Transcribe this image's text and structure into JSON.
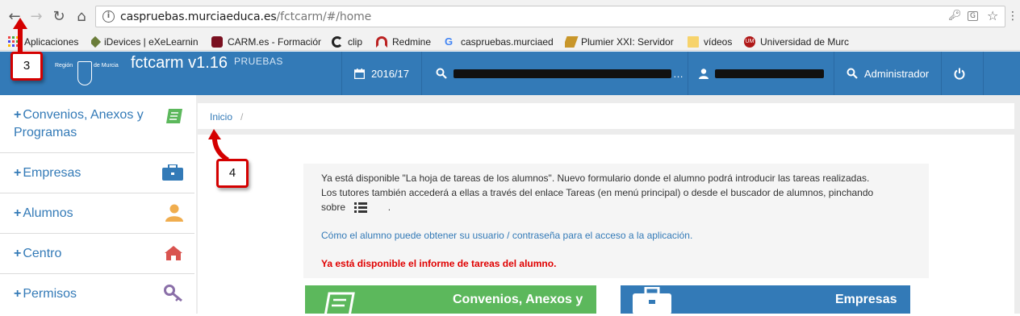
{
  "browser": {
    "url_host": "caspruebas.murciaeduca.es",
    "url_path": "/fctcarm/#/home",
    "bookmarks": [
      {
        "label": "Aplicaciones",
        "icon": "apps-grid-icon"
      },
      {
        "label": "iDevices | eXeLearnin",
        "icon": "idevices-icon"
      },
      {
        "label": "CARM.es - Formación",
        "icon": "carm-icon"
      },
      {
        "label": "clip",
        "icon": "clip-icon"
      },
      {
        "label": "Redmine",
        "icon": "redmine-icon"
      },
      {
        "label": "caspruebas.murciaed",
        "icon": "google-icon"
      },
      {
        "label": "Plumier XXI: Servidor",
        "icon": "plumier-icon"
      },
      {
        "label": "vídeos",
        "icon": "folder-icon"
      },
      {
        "label": "Universidad de Murc",
        "icon": "um-icon"
      }
    ]
  },
  "header": {
    "region_left": "Región",
    "region_right": "de Murcia",
    "title": "fctcarm v1.16",
    "subtitle": "PRUEBAS",
    "year": "2016/17",
    "admin": "Administrador"
  },
  "sidebar": {
    "items": [
      {
        "label_line1": "Convenios, Anexos y",
        "label_line2": "Programas",
        "icon": "book-icon",
        "color": "#5cb85c"
      },
      {
        "label_line1": "Empresas",
        "icon": "briefcase-icon",
        "color": "#337ab7"
      },
      {
        "label_line1": "Alumnos",
        "icon": "user-icon",
        "color": "#f0ad4e"
      },
      {
        "label_line1": "Centro",
        "icon": "home-icon",
        "color": "#d9534f"
      },
      {
        "label_line1": "Permisos",
        "icon": "key-icon",
        "color": "#8a6fa8"
      }
    ]
  },
  "breadcrumb": {
    "home": "Inicio",
    "sep": "/"
  },
  "notice": {
    "line1": "Ya está disponible \"La hoja de tareas de los alumnos\". Nuevo formulario donde el alumno podrá introducir las tareas realizadas.",
    "line2": "Los tutores también accederá a ellas a través del enlace Tareas (en menú principal) o desde el buscador de alumnos, pinchando",
    "line3_prefix": "sobre",
    "line3_suffix": ".",
    "link": "Cómo el alumno puede obtener su usuario / contraseña para el acceso a la aplicación.",
    "alert": "Ya está disponible el informe de tareas del alumno."
  },
  "tiles": [
    {
      "label": "Convenios, Anexos y",
      "color": "#5cb85c",
      "icon": "book-icon"
    },
    {
      "label": "Empresas",
      "color": "#337ab7",
      "icon": "briefcase-icon"
    }
  ],
  "markers": [
    "3",
    "4"
  ]
}
